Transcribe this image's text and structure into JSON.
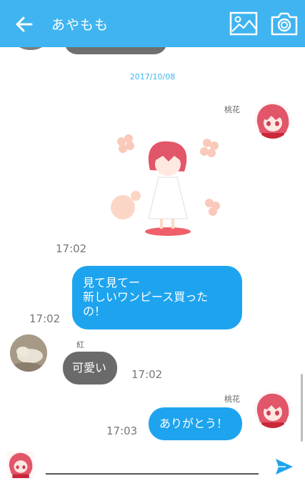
{
  "header": {
    "title": "あやもも"
  },
  "date_separator": "2017/10/08",
  "messages": [
    {
      "sender": "桃花",
      "type": "sticker",
      "time": "17:02"
    },
    {
      "sender": "桃花",
      "type": "text",
      "line1": "見て見てー",
      "line2": "新しいワンピース買った",
      "line3": "の！",
      "time": "17:02"
    },
    {
      "sender": "紅",
      "type": "text",
      "text": "可愛い",
      "time": "17:02"
    },
    {
      "sender": "桃花",
      "type": "text",
      "text": "ありがとう！",
      "time": "17:03"
    }
  ],
  "colors": {
    "accent": "#3fb4f0",
    "bubble_self": "#1ea4ef",
    "bubble_other": "#6a6a6a"
  },
  "icons": {
    "back": "arrow-left-icon",
    "image": "image-icon",
    "camera": "camera-icon",
    "send": "send-icon"
  }
}
